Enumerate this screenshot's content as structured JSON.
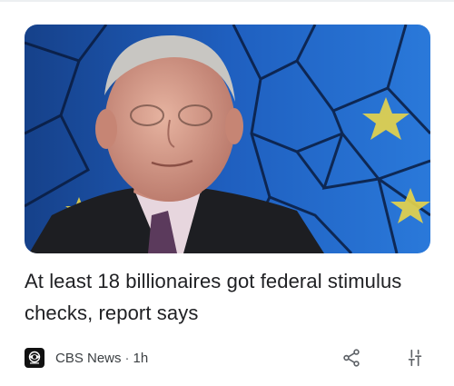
{
  "article": {
    "headline": "At least 18 billionaires got federal stimulus checks, report says",
    "source": "CBS News",
    "separator": "·",
    "age": "1h",
    "image_alt": "photo of an elderly man in a dark suit and purple tie against a blue stained-glass background"
  },
  "icons": {
    "source_logo": "cbs-eye-icon",
    "share": "share-icon",
    "more": "tune-sliders-icon"
  },
  "colors": {
    "headline": "#202124",
    "meta": "#3c4043",
    "icon": "#5f6368",
    "hero_blue": "#1f5fbf"
  }
}
